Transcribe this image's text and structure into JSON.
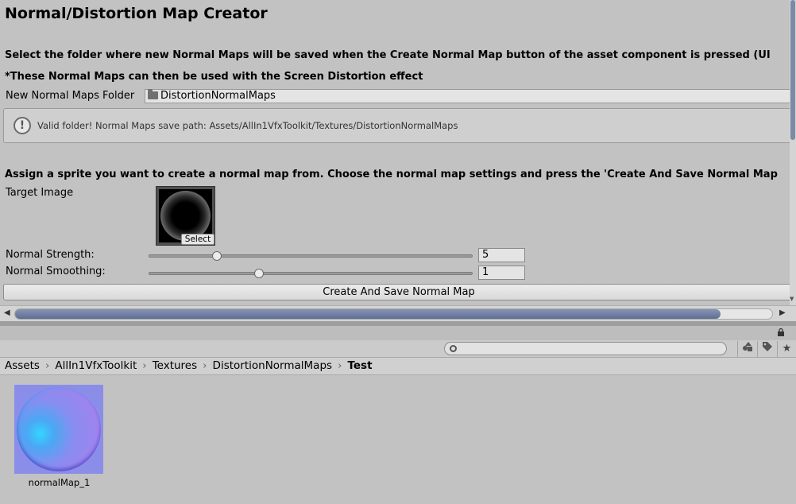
{
  "editor": {
    "title": "Normal/Distortion Map Creator",
    "description_line1": "Select the folder where new Normal Maps will be saved when the Create Normal Map button of the asset component is pressed (UI",
    "description_line2": "*These Normal Maps can then be used with the Screen Distortion effect",
    "folder_label": "New Normal Maps Folder",
    "folder_value": "DistortionNormalMaps",
    "folder_icon": "folder-icon",
    "help_message": "Valid folder! Normal Maps save path: Assets/AllIn1VfxToolkit/Textures/DistortionNormalMaps",
    "help_icon": "exclamation-icon",
    "assign_text": "Assign a sprite you want to create a normal map from. Choose the normal map settings and press the 'Create And Save Normal Map",
    "target_label": "Target Image",
    "select_label": "Select",
    "strength_label": "Normal Strength:",
    "strength_value": "5",
    "strength_fraction": 0.21,
    "smoothing_label": "Normal Smoothing:",
    "smoothing_value": "1",
    "smoothing_fraction": 0.34,
    "create_button": "Create And Save Normal Map"
  },
  "scroll": {
    "left_arrow": "◀",
    "right_arrow": "▶"
  },
  "project": {
    "breadcrumb": [
      "Assets",
      "AllIn1VfxToolkit",
      "Textures",
      "DistortionNormalMaps"
    ],
    "breadcrumb_current": "Test",
    "toolbar_icons": [
      "filter-by-type-icon",
      "filter-by-label-icon",
      "favorite-star-icon"
    ],
    "asset_name": "normalMap_1"
  }
}
